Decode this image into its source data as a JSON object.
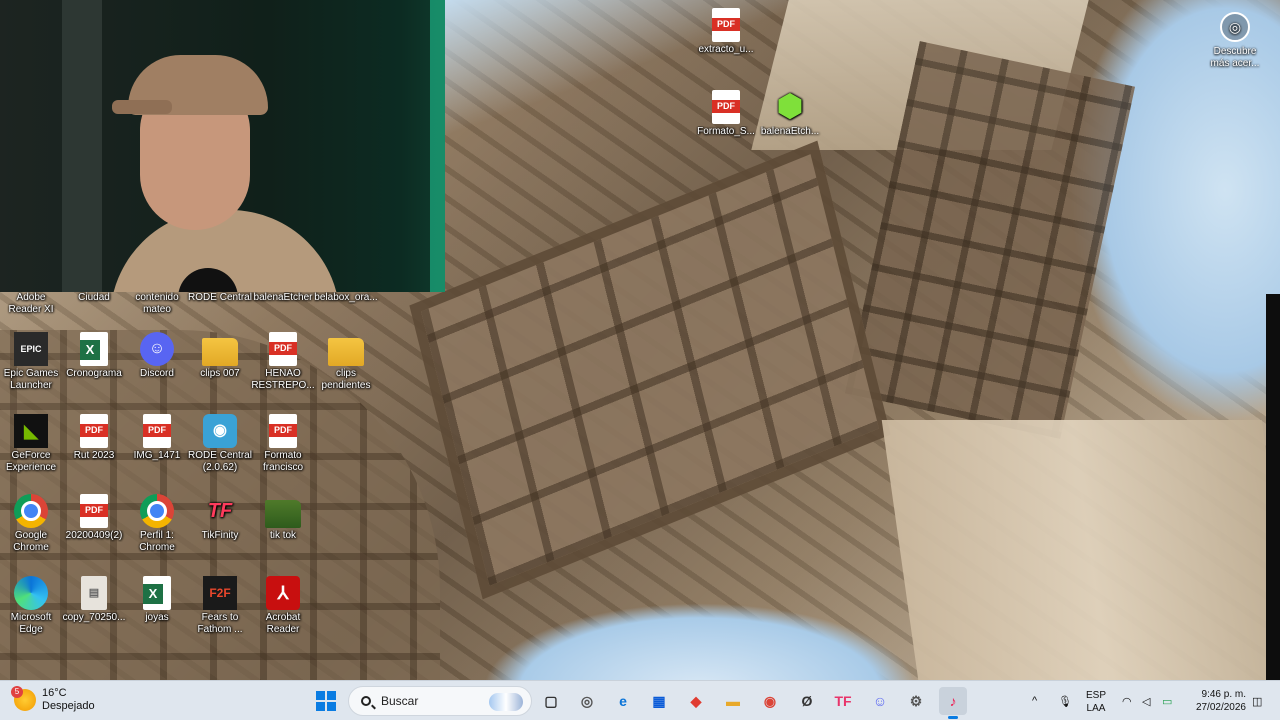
{
  "desktop": {
    "icons": [
      {
        "label": "Adobe\nReader XI",
        "type": "file"
      },
      {
        "label": "Ciudad",
        "type": "file"
      },
      {
        "label": "contenido\nmateo",
        "type": "file"
      },
      {
        "label": "RODE Central",
        "type": "file"
      },
      {
        "label": "balenaEtcher",
        "type": "file"
      },
      {
        "label": "belabox_ora...",
        "type": "file"
      },
      {
        "label": "Epic Games\nLauncher",
        "type": "epic",
        "glyph": "EPIC"
      },
      {
        "label": "Cronograma",
        "type": "xls"
      },
      {
        "label": "Discord",
        "type": "discord",
        "glyph": "☺"
      },
      {
        "label": "clips 007",
        "type": "folder"
      },
      {
        "label": "HENAO\nRESTREPO...",
        "type": "pdf"
      },
      {
        "label": "clips\npendientes",
        "type": "folder"
      },
      {
        "label": "GeForce\nExperience",
        "type": "nvidia",
        "glyph": "◣"
      },
      {
        "label": "Rut 2023",
        "type": "pdf"
      },
      {
        "label": "IMG_1471",
        "type": "pdf"
      },
      {
        "label": "RODE Central\n(2.0.62)",
        "type": "rode",
        "glyph": "◉"
      },
      {
        "label": "Formato\nfrancisco",
        "type": "pdf"
      },
      {
        "label": "Google\nChrome",
        "type": "chrome"
      },
      {
        "label": "20200409(2)",
        "type": "pdf"
      },
      {
        "label": "Perfil 1:\nChrome",
        "type": "chrome"
      },
      {
        "label": "TikFinity",
        "type": "tikfinity",
        "glyph": "TF"
      },
      {
        "label": "tik tok",
        "type": "folder-dark"
      },
      {
        "label": "Microsoft\nEdge",
        "type": "edge"
      },
      {
        "label": "copy_70250...",
        "type": "file",
        "glyph": "▤"
      },
      {
        "label": "joyas",
        "type": "xls"
      },
      {
        "label": "Fears to\nFathom ...",
        "type": "f2f",
        "glyph": "F2F"
      },
      {
        "label": "Acrobat\nReader",
        "type": "acrobat",
        "glyph": "⅄"
      },
      {
        "label": "extracto_u...",
        "type": "pdf"
      },
      {
        "label": "Formato_S...",
        "type": "pdf"
      },
      {
        "label": "balenaEtch...",
        "type": "cube",
        "glyph": "⬢"
      }
    ],
    "discover": {
      "label": "Descubre\nmás acer...",
      "icon": "camera-icon"
    }
  },
  "taskbar": {
    "weather": {
      "temp": "16°C",
      "condition": "Despejado",
      "badge": "5"
    },
    "search_placeholder": "Buscar",
    "apps": [
      {
        "name": "task-view",
        "glyph": "▢",
        "color": "#333333"
      },
      {
        "name": "copilot",
        "glyph": "◎",
        "color": "#555555"
      },
      {
        "name": "edge",
        "glyph": "e",
        "color": "#0a74d8"
      },
      {
        "name": "store",
        "glyph": "▦",
        "color": "#0a5bd8"
      },
      {
        "name": "anydesk",
        "glyph": "◆",
        "color": "#e03c31"
      },
      {
        "name": "explorer",
        "glyph": "▬",
        "color": "#e8a92a"
      },
      {
        "name": "chrome",
        "glyph": "◉",
        "color": "#db4437"
      },
      {
        "name": "unknown-app",
        "glyph": "Ø",
        "color": "#333333"
      },
      {
        "name": "tikfinity",
        "glyph": "TF",
        "color": "#e8346a"
      },
      {
        "name": "discord",
        "glyph": "☺",
        "color": "#5865f2"
      },
      {
        "name": "settings",
        "glyph": "⚙",
        "color": "#555555"
      },
      {
        "name": "tiktok-live",
        "glyph": "♪",
        "color": "#ee1d52"
      }
    ],
    "tray": {
      "chevron": "^",
      "mic": "🎙",
      "lang_line1": "ESP",
      "lang_line2": "LAA",
      "wifi": "◠",
      "volume": "◁",
      "battery": "▭",
      "time": "9:46 p. m.",
      "date": "27/02/2026",
      "notif": "◫"
    }
  },
  "colors": {
    "accent": "#0a7ce2",
    "taskbar_bg": "#dfe6ee"
  }
}
